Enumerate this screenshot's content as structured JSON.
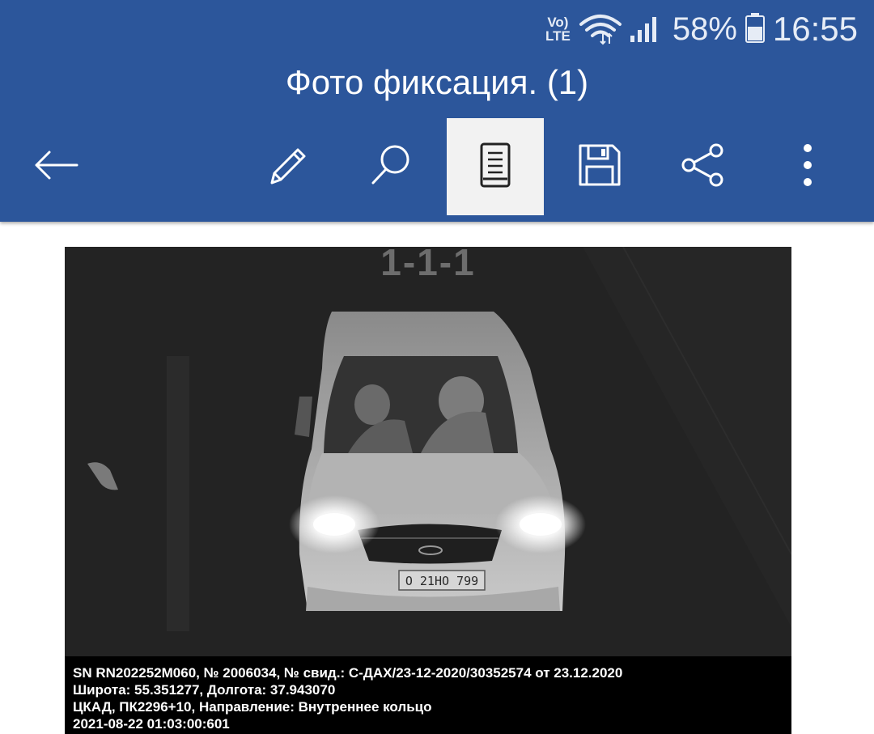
{
  "status_bar": {
    "volte_top": "Vo)",
    "volte_bottom": "LTE",
    "wifi_icon": "wifi-icon",
    "signal_icon": "signal-icon",
    "battery_percent": "58%",
    "battery_icon": "battery-icon",
    "time": "16:55"
  },
  "app_bar": {
    "title": "Фото фиксация. (1)",
    "actions": [
      {
        "name": "back",
        "icon": "arrow-left-icon"
      },
      {
        "name": "edit",
        "icon": "pencil-icon"
      },
      {
        "name": "search",
        "icon": "search-icon"
      },
      {
        "name": "reading-mode",
        "icon": "document-view-icon",
        "active": true
      },
      {
        "name": "save",
        "icon": "floppy-disk-icon"
      },
      {
        "name": "share",
        "icon": "share-icon"
      },
      {
        "name": "more",
        "icon": "more-vertical-icon"
      }
    ]
  },
  "photo": {
    "label": "1-1-1",
    "plate": "О 21НО 799",
    "overlay": {
      "line1": "SN  RN202252M060, № 2006034, № свид.: С-ДАХ/23-12-2020/30352574 от 23.12.2020",
      "line2": "Широта: 55.351277, Долгота: 37.943070",
      "line3": "ЦКАД, ПК2296+10, Направление: Внутреннее кольцо",
      "line4": "2021-08-22 01:03:00:601"
    }
  },
  "colors": {
    "app_bar": "#2c569b",
    "active_button": "#f2f2f2",
    "photo_background": "#232323",
    "overlay_background": "#000000"
  }
}
